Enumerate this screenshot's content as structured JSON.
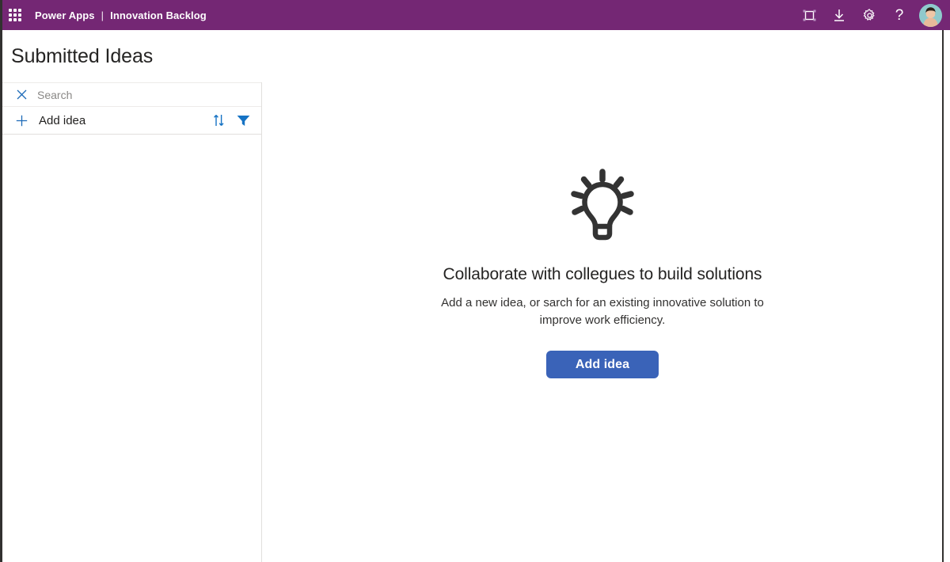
{
  "topbar": {
    "waffle_label": "app-launcher",
    "brand": "Power Apps",
    "separator": "|",
    "app_name": "Innovation Backlog",
    "icons": [
      {
        "name": "fit-screen-icon",
        "label": "Fit to screen"
      },
      {
        "name": "download-icon",
        "label": "Download"
      },
      {
        "name": "gear-icon",
        "label": "Settings"
      }
    ],
    "help_glyph": "?",
    "avatar_label": "User account",
    "background": "#742774"
  },
  "page": {
    "title": "Submitted Ideas"
  },
  "sidebar": {
    "search": {
      "placeholder": "Search",
      "value": "",
      "clear_icon": "close-icon"
    },
    "add_row": {
      "plus_icon": "plus-icon",
      "label": "Add idea",
      "sort_icon": "sort-icon",
      "filter_icon": "filter-icon",
      "accent": "#1673c4"
    },
    "items": []
  },
  "main": {
    "empty_state": {
      "illustration": "lightbulb-icon",
      "heading": "Collaborate with collegues to build solutions",
      "description": "Add a new idea, or sarch for an existing innovative solution to improve work efficiency.",
      "button_label": "Add idea",
      "button_color": "#3a63b8"
    }
  }
}
